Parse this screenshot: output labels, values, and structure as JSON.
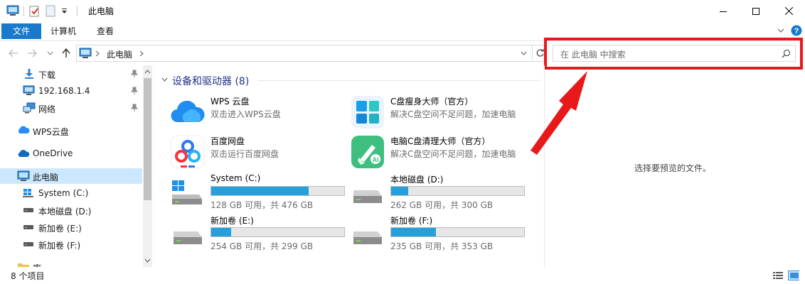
{
  "window": {
    "title": "此电脑"
  },
  "ribbon": {
    "tabs": [
      "文件",
      "计算机",
      "查看"
    ]
  },
  "address": {
    "path": "此电脑"
  },
  "search": {
    "placeholder": "在 此电脑 中搜索"
  },
  "sidebar": {
    "items": [
      {
        "label": "下载",
        "icon": "download-icon",
        "pinned": true
      },
      {
        "label": "192.168.1.4",
        "icon": "monitor-icon",
        "pinned": true
      },
      {
        "label": "网络",
        "icon": "network-icon",
        "pinned": true
      },
      {
        "label": "WPS云盘",
        "icon": "cloud-icon",
        "pinned": false
      },
      {
        "label": "OneDrive",
        "icon": "onedrive-icon",
        "pinned": false
      },
      {
        "label": "此电脑",
        "icon": "computer-icon",
        "pinned": false
      },
      {
        "label": "System (C:)",
        "icon": "windows-drive-icon",
        "pinned": false
      },
      {
        "label": "本地磁盘 (D:)",
        "icon": "drive-icon",
        "pinned": false
      },
      {
        "label": "新加卷 (E:)",
        "icon": "drive-icon",
        "pinned": false
      },
      {
        "label": "新加卷 (F:)",
        "icon": "drive-icon",
        "pinned": false
      },
      {
        "label": "库",
        "icon": "library-icon",
        "pinned": false
      }
    ]
  },
  "content": {
    "group_header": "设备和驱动器 (8)",
    "apps": [
      {
        "name": "WPS 云盘",
        "desc": "双击进入WPS云盘"
      },
      {
        "name": "C盘瘦身大师（官方）",
        "desc": "解决C盘空间不足问题，加速电脑"
      },
      {
        "name": "百度网盘",
        "desc": "双击运行百度网盘"
      },
      {
        "name": "电脑C盘清理大师（官方）",
        "desc": "解决C盘空间不足问题，加速电脑"
      }
    ],
    "drives": [
      {
        "name": "System (C:)",
        "free": "128 GB 可用，共 476 GB",
        "used_fraction": 0.731
      },
      {
        "name": "本地磁盘 (D:)",
        "free": "262 GB 可用，共 300 GB",
        "used_fraction": 0.127
      },
      {
        "name": "新加卷 (E:)",
        "free": "254 GB 可用，共 299 GB",
        "used_fraction": 0.151
      },
      {
        "name": "新加卷 (F:)",
        "free": "235 GB 可用，共 353 GB",
        "used_fraction": 0.334
      }
    ]
  },
  "preview": {
    "text": "选择要预览的文件。"
  },
  "status": {
    "count": "8 个项目"
  },
  "colors": {
    "accent": "#1979ca",
    "highlight": "#e8191b",
    "selected": "#cce8ff",
    "bar_fill": "#26a0da"
  }
}
